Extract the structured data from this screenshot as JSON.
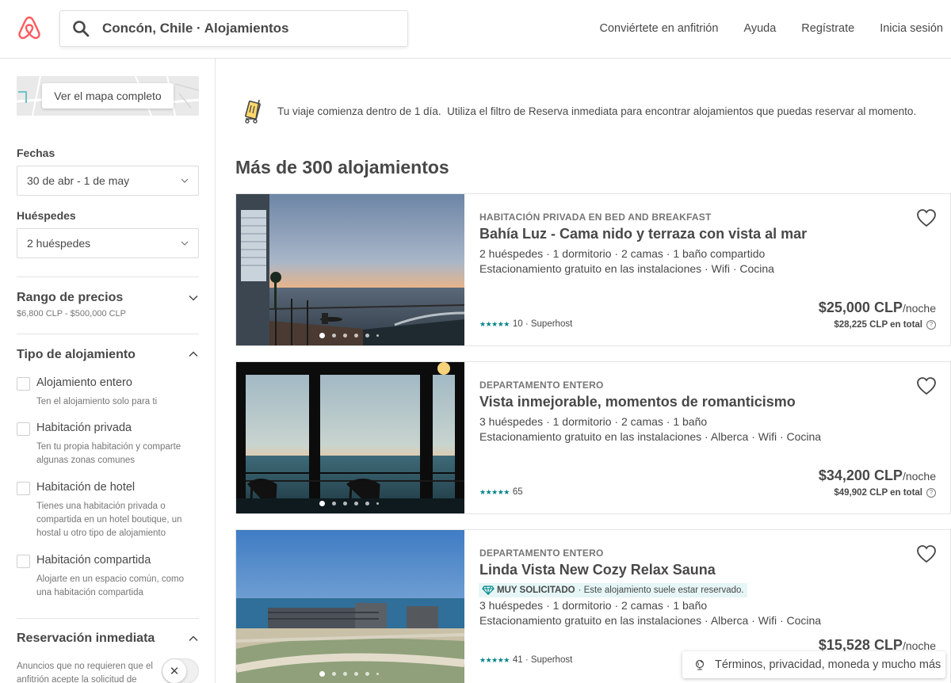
{
  "header": {
    "search_text": "Concón, Chile · Alojamientos",
    "nav": [
      "Conviértete en anfitrión",
      "Ayuda",
      "Regístrate",
      "Inicia sesión"
    ]
  },
  "sidebar": {
    "map_button": "Ver el mapa completo",
    "dates_label": "Fechas",
    "dates_value": "30 de abr - 1 de may",
    "guests_label": "Huéspedes",
    "guests_value": "2 huéspedes",
    "price_title": "Rango de precios",
    "price_range": "$6,800 CLP - $500,000 CLP",
    "type_title": "Tipo de alojamiento",
    "types": [
      {
        "label": "Alojamiento entero",
        "desc": "Ten el alojamiento solo para ti"
      },
      {
        "label": "Habitación privada",
        "desc": "Ten tu propia habitación y comparte algunas zonas comunes"
      },
      {
        "label": "Habitación de hotel",
        "desc": "Tienes una habitación privada o compartida en un hotel boutique, un hostal u otro tipo de alojamiento"
      },
      {
        "label": "Habitación compartida",
        "desc": "Alojarte en un espacio común, como una habitación compartida"
      }
    ],
    "instant_title": "Reservación inmediata",
    "instant_desc": "Anuncios que no requieren que el anfitrión acepte la solicitud de"
  },
  "banner": {
    "bold": "Tu viaje comienza dentro de 1 día.",
    "text": "Utiliza el filtro de Reserva inmediata para encontrar alojamientos que puedas reservar al momento."
  },
  "results_title": "Más de 300 alojamientos",
  "listings": [
    {
      "type": "HABITACIÓN PRIVADA EN BED AND BREAKFAST",
      "title": "Bahía Luz - Cama nido y terraza con vista al mar",
      "details": "2 huéspedes · 1 dormitorio · 2 camas · 1 baño compartido",
      "amenities": "Estacionamiento gratuito en las instalaciones · Wifi · Cocina",
      "stars": "★★★★★",
      "reviews": "10 · Superhost",
      "price": "$25,000 CLP",
      "per": "/noche",
      "total": "$28,225 CLP en total"
    },
    {
      "type": "DEPARTAMENTO ENTERO",
      "title": "Vista inmejorable, momentos de romanticismo",
      "details": "3 huéspedes · 1 dormitorio · 2 camas · 1 baño",
      "amenities": "Estacionamiento gratuito en las instalaciones · Alberca · Wifi · Cocina",
      "stars": "★★★★★",
      "reviews": "65",
      "price": "$34,200 CLP",
      "per": "/noche",
      "total": "$49,902 CLP en total"
    },
    {
      "type": "DEPARTAMENTO ENTERO",
      "title": "Linda Vista New Cozy Relax Sauna",
      "badge_bold": "MUY SOLICITADO",
      "badge_text": "· Este alojamiento suele estar reservado.",
      "details": "3 huéspedes · 1 dormitorio · 2 camas · 1 baño",
      "amenities": "Estacionamiento gratuito en las instalaciones · Alberca · Wifi · Cocina",
      "stars": "★★★★★",
      "reviews": "41 · Superhost",
      "price": "$15,528 CLP",
      "per": "/noche"
    }
  ],
  "footer_pill": "Términos, privacidad, moneda y mucho más",
  "colors": {
    "brand": "#FF5A5F",
    "teal": "#008489",
    "text": "#484848"
  }
}
